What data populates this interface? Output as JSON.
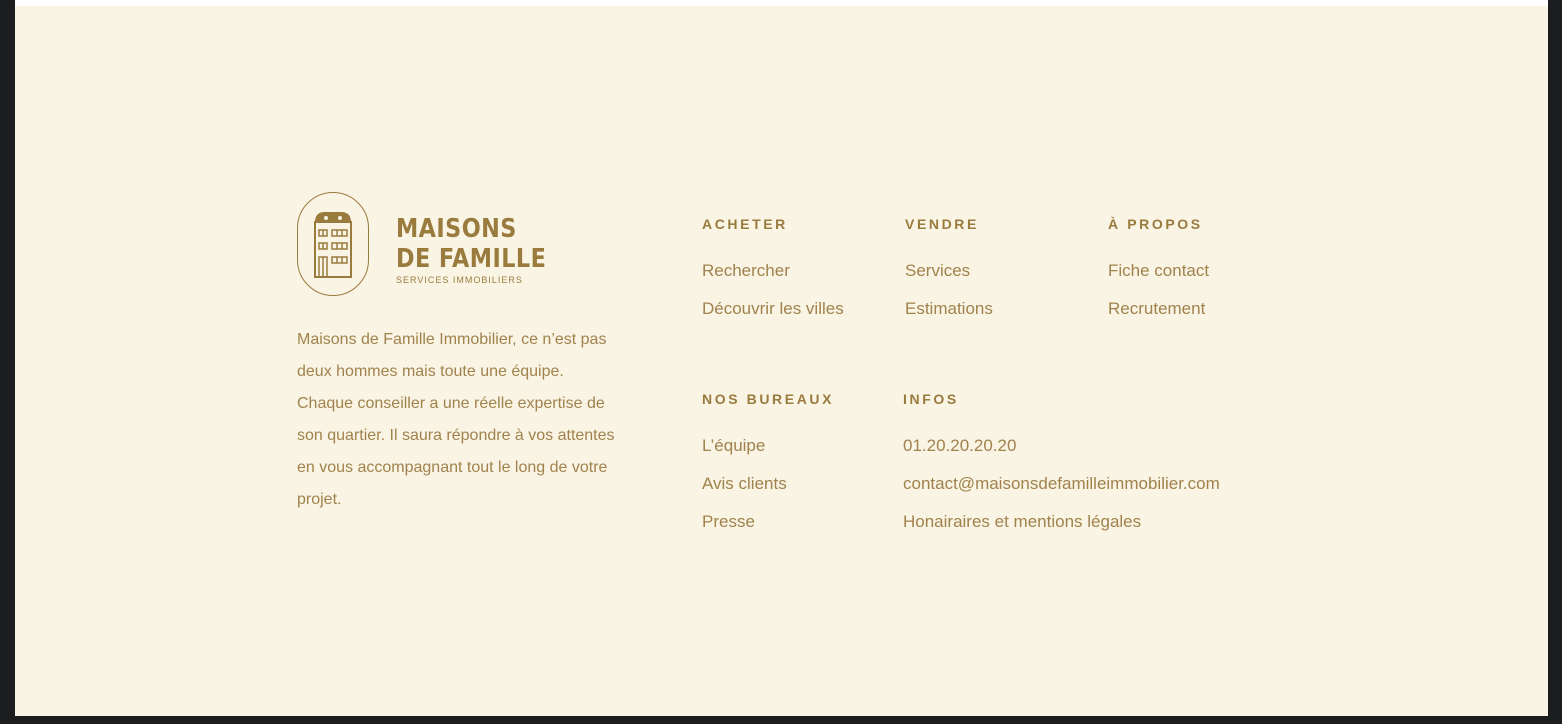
{
  "brand": {
    "line1": "MAISONS",
    "line2": "DE FAMILLE",
    "tagline": "SERVICES IMMOBILIERS",
    "description": "Maisons de Famille Immobilier, ce n’est pas deux hommes mais toute une équipe. Chaque conseiller a une réelle expertise de son quartier. Il saura répondre à vos attentes en vous accompagnant tout le long de votre projet.",
    "color": "#9a7b3e"
  },
  "columns": {
    "acheter": {
      "title": "ACHETER",
      "links": [
        "Rechercher",
        "Découvrir les villes"
      ]
    },
    "vendre": {
      "title": "VENDRE",
      "links": [
        "Services",
        "Estimations"
      ]
    },
    "propos": {
      "title": "À PROPOS",
      "links": [
        "Fiche contact",
        "Recrutement"
      ]
    },
    "bureaux": {
      "title": "NOS BUREAUX",
      "links": [
        "L’équipe",
        "Avis clients",
        "Presse"
      ]
    },
    "infos": {
      "title": "INFOS",
      "links": [
        "01.20.20.20.20",
        "contact@maisonsdefamilleimmobilier.com",
        "Honairaires et mentions légales"
      ]
    }
  },
  "colors": {
    "background": "#faf4e5",
    "text": "#a0824c",
    "frame": "#1c1d1e"
  }
}
